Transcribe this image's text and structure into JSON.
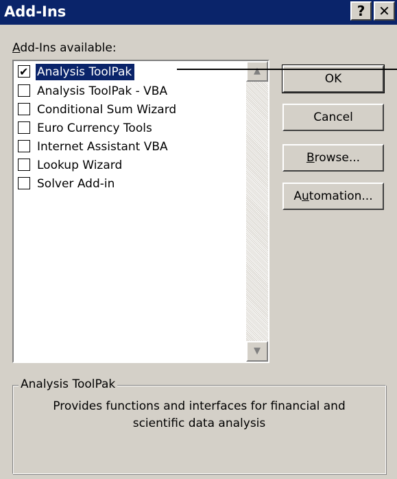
{
  "window": {
    "title": "Add-Ins",
    "help_label": "?",
    "close_label": "✕"
  },
  "addins": {
    "label_accel": "A",
    "label_rest": "dd-Ins available:",
    "items": [
      {
        "label": "Analysis ToolPak",
        "checked": true,
        "selected": true
      },
      {
        "label": "Analysis ToolPak - VBA",
        "checked": false,
        "selected": false
      },
      {
        "label": "Conditional Sum Wizard",
        "checked": false,
        "selected": false
      },
      {
        "label": "Euro Currency Tools",
        "checked": false,
        "selected": false
      },
      {
        "label": "Internet Assistant VBA",
        "checked": false,
        "selected": false
      },
      {
        "label": "Lookup Wizard",
        "checked": false,
        "selected": false
      },
      {
        "label": "Solver Add-in",
        "checked": false,
        "selected": false
      }
    ]
  },
  "buttons": {
    "ok": "OK",
    "cancel": "Cancel",
    "browse_accel": "B",
    "browse_rest": "rowse...",
    "automation_pre": "A",
    "automation_accel": "u",
    "automation_rest": "tomation..."
  },
  "description": {
    "title": "Analysis ToolPak",
    "text": "Provides functions and interfaces for financial and scientific data analysis"
  },
  "colors": {
    "dialog_face": "#d4d0c8",
    "title_bar": "#0a246a",
    "selection": "#0a246a"
  }
}
